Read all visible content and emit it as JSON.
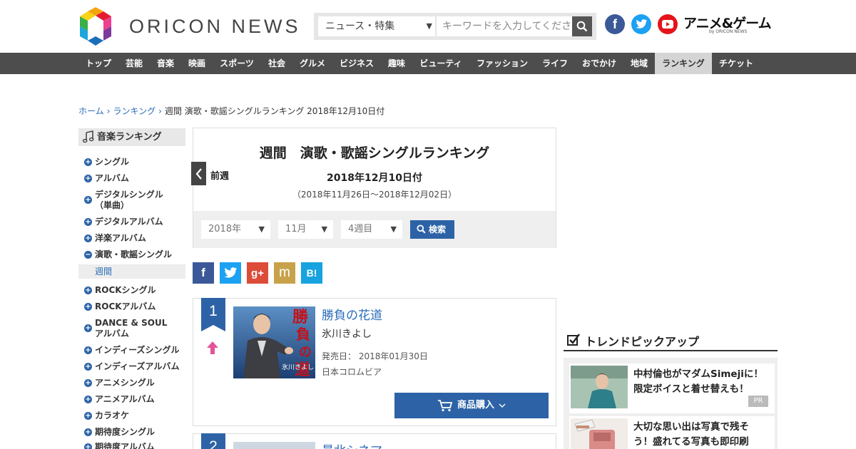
{
  "header": {
    "logo_text": "ORICON NEWS",
    "search_category": "ニュース・特集",
    "search_placeholder": "キーワードを入力してください",
    "anime_logo": "アニメ&ゲーム",
    "anime_logo_sub": "by ORICON NEWS"
  },
  "nav": [
    "トップ",
    "芸能",
    "音楽",
    "映画",
    "スポーツ",
    "社会",
    "グルメ",
    "ビジネス",
    "趣味",
    "ビューティ",
    "ファッション",
    "ライフ",
    "おでかけ",
    "地域",
    "ランキング",
    "チケット"
  ],
  "breadcrumb": {
    "home": "ホーム",
    "ranking": "ランキング",
    "current": "週間 演歌・歌謡シングルランキング 2018年12月10日付"
  },
  "sidebar": {
    "title": "音楽ランキング",
    "items": [
      "シングル",
      "アルバム",
      "デジタルシングル（単曲）",
      "デジタルアルバム",
      "洋楽アルバム",
      "演歌・歌謡シングル",
      "ROCKシングル",
      "ROCKアルバム",
      "DANCE & SOUL アルバム",
      "インディーズシングル",
      "インディーズアルバム",
      "アニメシングル",
      "アニメアルバム",
      "カラオケ",
      "期待度シングル",
      "期待度アルバム"
    ],
    "item_line1": [
      "シングル",
      "アルバム",
      "デジタルシングル",
      "デジタルアルバム",
      "洋楽アルバム",
      "演歌・歌謡シングル",
      "ROCKシングル",
      "ROCKアルバム",
      "DANCE & SOUL",
      "インディーズシングル",
      "インディーズアルバム",
      "アニメシングル",
      "アニメアルバム",
      "カラオケ",
      "期待度シングル",
      "期待度アルバム"
    ],
    "item_line2": [
      "",
      "",
      "（単曲）",
      "",
      "",
      "",
      "",
      "",
      "アルバム",
      "",
      "",
      "",
      "",
      "",
      "",
      ""
    ],
    "sub_item": "週間"
  },
  "ranking": {
    "title": "週間　演歌・歌謡シングルランキング",
    "prev_label": "前週",
    "date": "2018年12月10日付",
    "range": "（2018年11月26日～2018年12月02日）",
    "year": "2018年",
    "month": "11月",
    "week": "4週目",
    "search_label": "検索"
  },
  "share": [
    "f",
    "t",
    "g+",
    "m",
    "B!"
  ],
  "entries": [
    {
      "rank": "1",
      "title": "勝負の花道",
      "artist": "氷川きよし",
      "release": "発売日：  2018年01月30日",
      "label": "日本コロムビア",
      "buy": "商品購入",
      "jacket_text": "勝負の花道"
    },
    {
      "rank": "2",
      "title": "最北シネマ"
    }
  ],
  "trend": {
    "title": "トレンドピックアップ",
    "items": [
      {
        "text": "中村倫也がマダムSimejiに！限定ボイスと着せ替えも！",
        "line1": "中村倫也がマダムSimejiに！",
        "line2": "限定ボイスと着せ替えも！",
        "badge": "PR"
      },
      {
        "text": "大切な思い出は写真で残そう！盛れてる写真も即印刷",
        "line1": "大切な思い出は写真で残そ",
        "line2": "う！盛れてる写真も即印刷"
      }
    ]
  },
  "colors": {
    "nav_bg": "#4d4d4d",
    "accent_blue": "#2d63a6",
    "link_blue": "#2a6cb8",
    "rank_up": "#e4539b"
  }
}
